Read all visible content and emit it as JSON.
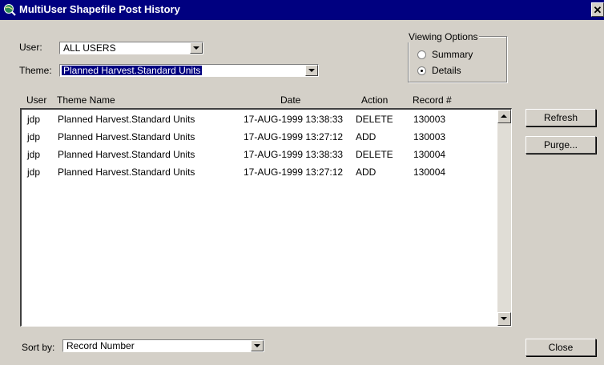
{
  "window": {
    "title": "MultiUser Shapefile Post History",
    "close_glyph": "✕"
  },
  "filters": {
    "user_label": "User:",
    "user_value": "ALL USERS",
    "theme_label": "Theme:",
    "theme_value": "Planned Harvest.Standard Units"
  },
  "viewing_options": {
    "title": "Viewing Options",
    "options": [
      {
        "label": "Summary",
        "checked": false
      },
      {
        "label": "Details",
        "checked": true
      }
    ]
  },
  "list": {
    "columns": [
      "User",
      "Theme Name",
      "Date",
      "Action",
      "Record #"
    ],
    "rows": [
      {
        "user": "jdp",
        "theme": "Planned Harvest.Standard Units",
        "date": "17-AUG-1999 13:38:33",
        "action": "DELETE",
        "record": "130003"
      },
      {
        "user": "jdp",
        "theme": "Planned Harvest.Standard Units",
        "date": "17-AUG-1999 13:27:12",
        "action": "ADD",
        "record": "130003"
      },
      {
        "user": "jdp",
        "theme": "Planned Harvest.Standard Units",
        "date": "17-AUG-1999 13:38:33",
        "action": "DELETE",
        "record": "130004"
      },
      {
        "user": "jdp",
        "theme": "Planned Harvest.Standard Units",
        "date": "17-AUG-1999 13:27:12",
        "action": "ADD",
        "record": "130004"
      }
    ]
  },
  "buttons": {
    "refresh": "Refresh",
    "purge": "Purge...",
    "close": "Close"
  },
  "sort": {
    "label": "Sort by:",
    "value": "Record Number"
  },
  "icons": {
    "app": "globe-search-icon",
    "combo_arrow": "chevron-down-icon",
    "scroll_up": "arrow-up-icon",
    "scroll_down": "arrow-down-icon"
  },
  "colors": {
    "titlebar": "#000080",
    "face": "#d4d0c8",
    "selection": "#000080"
  }
}
